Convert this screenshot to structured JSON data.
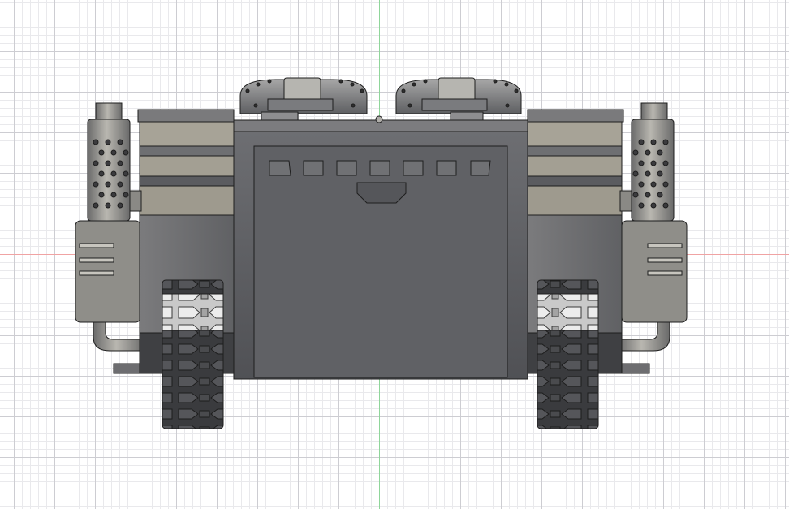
{
  "viewport": {
    "view_name": "",
    "colors": {
      "background": "#ffffff",
      "grid_major": "#cdcdd2",
      "grid_minor": "#e9e9ec",
      "axis_vertical": "#8fd59a",
      "axis_horizontal": "#f0a3a3",
      "hull_dark": "#55565a",
      "hull_mid": "#75767a",
      "hull_light": "#9b9a95",
      "panel_beige": "#a7a397",
      "track": "#3c3d40",
      "track_highlight": "#d8d8d8",
      "outline": "#1e1e1e"
    },
    "model": {
      "name": "",
      "description_visible": false
    }
  }
}
